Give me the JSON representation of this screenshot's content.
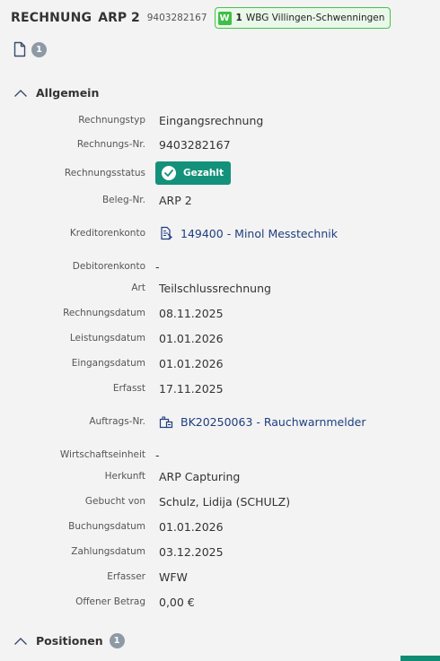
{
  "header": {
    "doc_type": "RECHNUNG",
    "doc_id": "ARP 2",
    "doc_number": "9403282167",
    "company": {
      "logo": "W",
      "code": "1",
      "name": "WBG Villingen-Schwenningen",
      "color": "#3fbf47"
    }
  },
  "attachments": {
    "icon": "file-icon",
    "count": "1"
  },
  "sections": {
    "general": {
      "title": "Allgemein"
    },
    "positions": {
      "title": "Positionen",
      "count": "1"
    }
  },
  "fields": {
    "rechnungstyp": {
      "label": "Rechnungstyp",
      "value": "Eingangsrechnung"
    },
    "rechnungs_nr": {
      "label": "Rechnungs-Nr.",
      "value": "9403282167"
    },
    "rechnungsstatus": {
      "label": "Rechnungsstatus",
      "value": "Gezahlt",
      "color": "#14917b"
    },
    "beleg_nr": {
      "label": "Beleg-Nr.",
      "value": "ARP 2"
    },
    "kreditorenkonto": {
      "label": "Kreditorenkonto",
      "value": "149400 - Minol Messtechnik",
      "icon": "creditor-account-icon"
    },
    "debitorenkonto": {
      "label": "Debitorenkonto",
      "value": "-"
    },
    "art": {
      "label": "Art",
      "value": "Teilschlussrechnung"
    },
    "rechnungsdatum": {
      "label": "Rechnungsdatum",
      "value": "08.11.2025"
    },
    "leistungsdatum": {
      "label": "Leistungsdatum",
      "value": "01.01.2026"
    },
    "eingangsdatum": {
      "label": "Eingangsdatum",
      "value": "01.01.2026"
    },
    "erfasst": {
      "label": "Erfasst",
      "value": "17.11.2025"
    },
    "auftrags_nr": {
      "label": "Auftrags-Nr.",
      "value": "BK20250063 - Rauchwarnmelder",
      "icon": "order-icon"
    },
    "wirtschaftseinheit": {
      "label": "Wirtschaftseinheit",
      "value": "-"
    },
    "herkunft": {
      "label": "Herkunft",
      "value": "ARP Capturing"
    },
    "gebucht_von": {
      "label": "Gebucht von",
      "value": "Schulz, Lidija (SCHULZ)"
    },
    "buchungsdatum": {
      "label": "Buchungsdatum",
      "value": "01.01.2026"
    },
    "zahlungsdatum": {
      "label": "Zahlungsdatum",
      "value": "03.12.2025"
    },
    "erfasser": {
      "label": "Erfasser",
      "value": "WFW"
    },
    "offener_betrag": {
      "label": "Offener Betrag",
      "value": "0,00 €"
    }
  },
  "colors": {
    "link": "#1f3e80",
    "accent": "#0e8c74",
    "background": "#f3f3f3"
  }
}
